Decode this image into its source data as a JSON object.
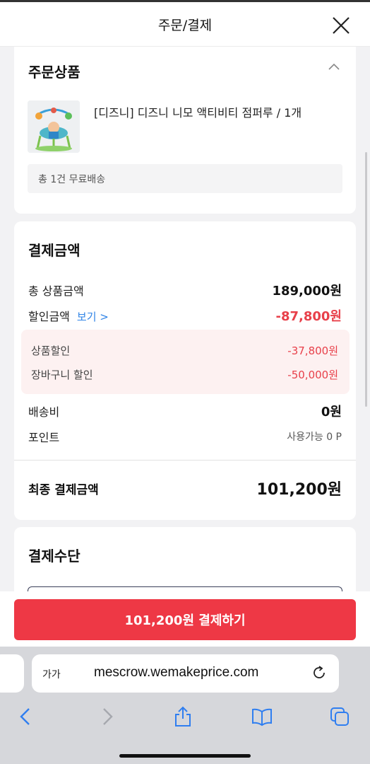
{
  "header": {
    "title": "주문/결제"
  },
  "products": {
    "section_title": "주문상품",
    "item_name": "[디즈니] 디즈니 니모 액티비티 점퍼루 / 1개",
    "shipping_summary": "총 1건 무료배송"
  },
  "payment": {
    "section_title": "결제금액",
    "total_label": "총 상품금액",
    "total_value": "189,000원",
    "discount_label": "할인금액",
    "discount_view_link": "보기 >",
    "discount_value": "-87,800원",
    "product_discount_label": "상품할인",
    "product_discount_value": "-37,800원",
    "cart_discount_label": "장바구니 할인",
    "cart_discount_value": "-50,000원",
    "shipping_label": "배송비",
    "shipping_value": "0원",
    "point_label": "포인트",
    "point_value": "사용가능 0 P",
    "final_label": "최종 결제금액",
    "final_value": "101,200원"
  },
  "method": {
    "section_title": "결제수단"
  },
  "pay_button": {
    "label": "101,200원 결제하기"
  },
  "browser": {
    "text_size_label": "가가",
    "url": "mescrow.wemakeprice.com"
  },
  "colors": {
    "accent": "#ee3845",
    "discount": "#e8404a",
    "link": "#2f83e6"
  }
}
